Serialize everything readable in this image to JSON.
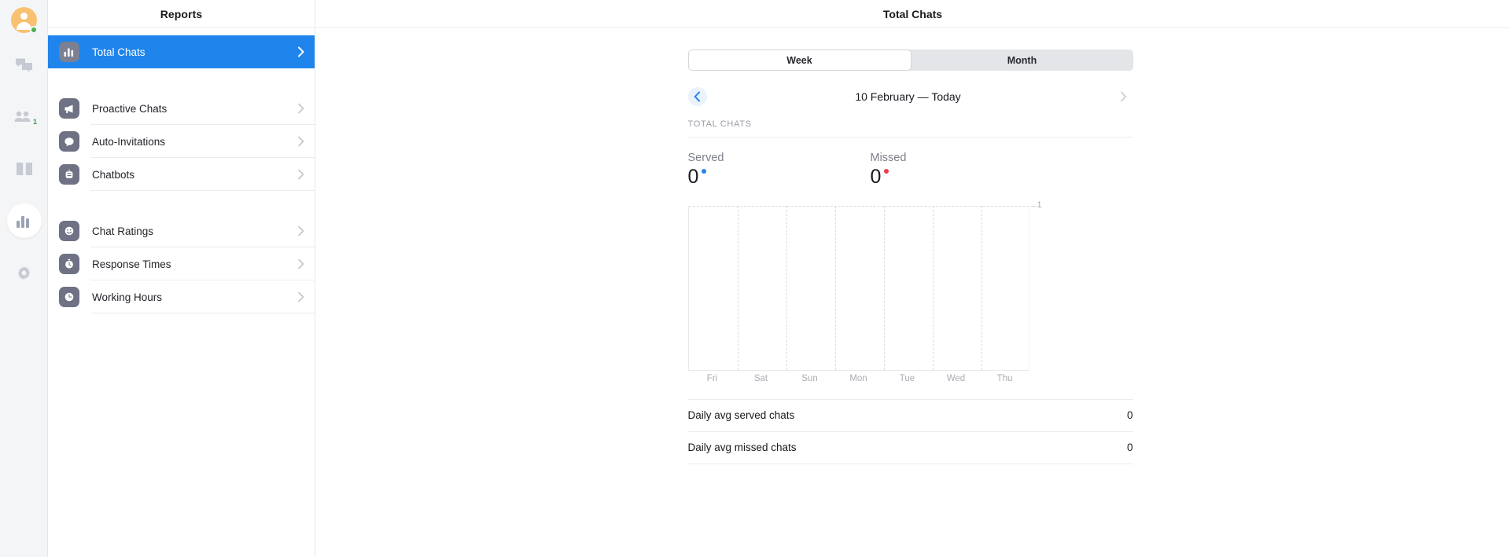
{
  "rail": {
    "items": [
      {
        "name": "avatar",
        "icon": "avatar-icon",
        "status": "online"
      },
      {
        "name": "chats",
        "icon": "chat-bubbles-icon"
      },
      {
        "name": "visitors",
        "icon": "visitors-icon",
        "badge": "1"
      },
      {
        "name": "archives",
        "icon": "book-icon"
      },
      {
        "name": "reports",
        "icon": "bar-chart-icon",
        "active": true
      },
      {
        "name": "settings",
        "icon": "gear-icon"
      }
    ]
  },
  "reports_panel": {
    "title": "Reports",
    "groups": [
      {
        "items": [
          {
            "label": "Total Chats",
            "icon": "bar-chart-icon",
            "selected": true
          }
        ]
      },
      {
        "items": [
          {
            "label": "Proactive Chats",
            "icon": "megaphone-icon",
            "selected": false
          },
          {
            "label": "Auto-Invitations",
            "icon": "speech-bubble-icon",
            "selected": false
          },
          {
            "label": "Chatbots",
            "icon": "robot-icon",
            "selected": false
          }
        ]
      },
      {
        "items": [
          {
            "label": "Chat Ratings",
            "icon": "smiley-icon",
            "selected": false
          },
          {
            "label": "Response Times",
            "icon": "stopwatch-icon",
            "selected": false
          },
          {
            "label": "Working Hours",
            "icon": "clock-icon",
            "selected": false
          }
        ]
      }
    ]
  },
  "main": {
    "title": "Total Chats",
    "range_tabs": [
      {
        "label": "Week",
        "active": true
      },
      {
        "label": "Month",
        "active": false
      }
    ],
    "date_range": "10 February — Today",
    "prev_label": "chevron-left-icon",
    "next_label": "chevron-right-icon",
    "section_label": "TOTAL CHATS",
    "metrics": [
      {
        "name": "Served",
        "value": "0",
        "color": "#1f84ec"
      },
      {
        "name": "Missed",
        "value": "0",
        "color": "#f0384a"
      }
    ],
    "summary": [
      {
        "label": "Daily avg served chats",
        "value": "0"
      },
      {
        "label": "Daily avg missed chats",
        "value": "0"
      }
    ]
  },
  "chart_data": {
    "type": "bar",
    "title": "Total Chats",
    "categories": [
      "Fri",
      "Sat",
      "Sun",
      "Mon",
      "Tue",
      "Wed",
      "Thu"
    ],
    "series": [
      {
        "name": "Served",
        "values": [
          0,
          0,
          0,
          0,
          0,
          0,
          0
        ],
        "color": "#1f84ec"
      },
      {
        "name": "Missed",
        "values": [
          0,
          0,
          0,
          0,
          0,
          0,
          0
        ],
        "color": "#f0384a"
      }
    ],
    "xlabel": "",
    "ylabel": "",
    "ylim": [
      0,
      1
    ],
    "ytick_labels": [
      "1"
    ],
    "grid": true,
    "legend_position": "top"
  },
  "colors": {
    "accent": "#1f84ec",
    "danger": "#f0384a",
    "rail_bg": "#f4f5f7",
    "icon_tile": "#6e7284"
  }
}
